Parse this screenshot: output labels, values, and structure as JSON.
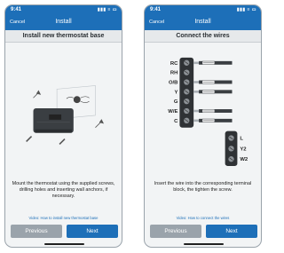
{
  "screens": [
    {
      "status_time": "9:41",
      "status_icons": "▮▮▮ ≡ ▭",
      "cancel_label": "Cancel",
      "title": "Install",
      "heading": "Install new thermostat base",
      "instruction": "Mount the thermostat using the supplied screws, drilling holes and inserting wall anchors, if necessary.",
      "video_link": "Video: How to install new thermostat base",
      "previous_label": "Previous",
      "next_label": "Next"
    },
    {
      "status_time": "9:41",
      "status_icons": "▮▮▮ ≡ ▭",
      "cancel_label": "Cancel",
      "title": "Install",
      "heading": "Connect the wires",
      "instruction": "Insert the wire into the corresponding terminal block, the tighten the screw.",
      "video_link": "Video: How to connect the wires",
      "previous_label": "Previous",
      "next_label": "Next",
      "terminal_block_top": [
        "RC",
        "RH",
        "O/B",
        "Y",
        "G",
        "W/E",
        "C"
      ],
      "terminal_block_bottom": [
        "L",
        "Y2",
        "W2"
      ],
      "connected_terminals": [
        "RC",
        "O/B",
        "Y",
        "W/E",
        "C"
      ]
    }
  ],
  "colors": {
    "header_blue": "#1d6fb8",
    "previous_gray": "#9aa3ab"
  }
}
